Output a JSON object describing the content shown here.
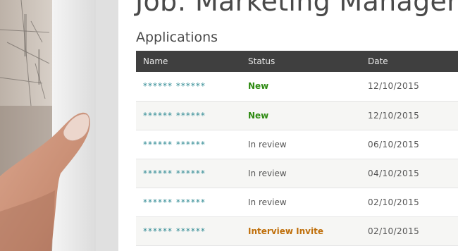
{
  "page": {
    "job_title": "Job: Marketing Manager",
    "section_title": "Applications"
  },
  "table": {
    "headers": {
      "name": "Name",
      "status": "Status",
      "date": "Date"
    },
    "rows": [
      {
        "name": "****** ******",
        "status": "New",
        "status_kind": "new",
        "date": "12/10/2015"
      },
      {
        "name": "****** ******",
        "status": "New",
        "status_kind": "new",
        "date": "12/10/2015"
      },
      {
        "name": "****** ******",
        "status": "In review",
        "status_kind": "review",
        "date": "06/10/2015"
      },
      {
        "name": "****** ******",
        "status": "In review",
        "status_kind": "review",
        "date": "04/10/2015"
      },
      {
        "name": "****** ******",
        "status": "In review",
        "status_kind": "review",
        "date": "02/10/2015"
      },
      {
        "name": "****** ******",
        "status": "Interview Invite",
        "status_kind": "invite",
        "date": "02/10/2015"
      }
    ]
  },
  "colors": {
    "header_bg": "#3f3f3f",
    "name_link": "#2f8a93",
    "status_new": "#2e8b12",
    "status_invite": "#c0700c"
  }
}
